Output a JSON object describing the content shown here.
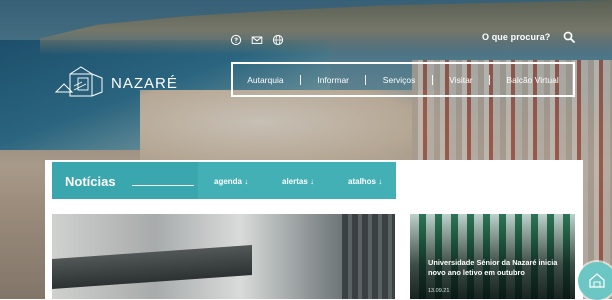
{
  "header": {
    "brand": "NAZARÉ",
    "search_label": "O que procura?",
    "top_icons": [
      "help-icon",
      "mail-icon",
      "globe-icon"
    ]
  },
  "nav": {
    "items": [
      {
        "label": "Autarquia"
      },
      {
        "label": "Informar"
      },
      {
        "label": "Serviços"
      },
      {
        "label": "Visitar"
      },
      {
        "label": "Balcão Virtual"
      }
    ]
  },
  "tabs": {
    "title": "Notícias",
    "items": [
      {
        "label": "agenda ↓"
      },
      {
        "label": "alertas ↓"
      },
      {
        "label": "atalhos ↓"
      }
    ]
  },
  "news": {
    "featured_headline": "Universidade Sénior da Nazaré inicia novo ano letivo em outubro",
    "featured_date": "13.09.21"
  },
  "colors": {
    "accent": "#43b0b6",
    "accent_dark": "#3aa6ad",
    "fab": "#6cc7c4"
  }
}
